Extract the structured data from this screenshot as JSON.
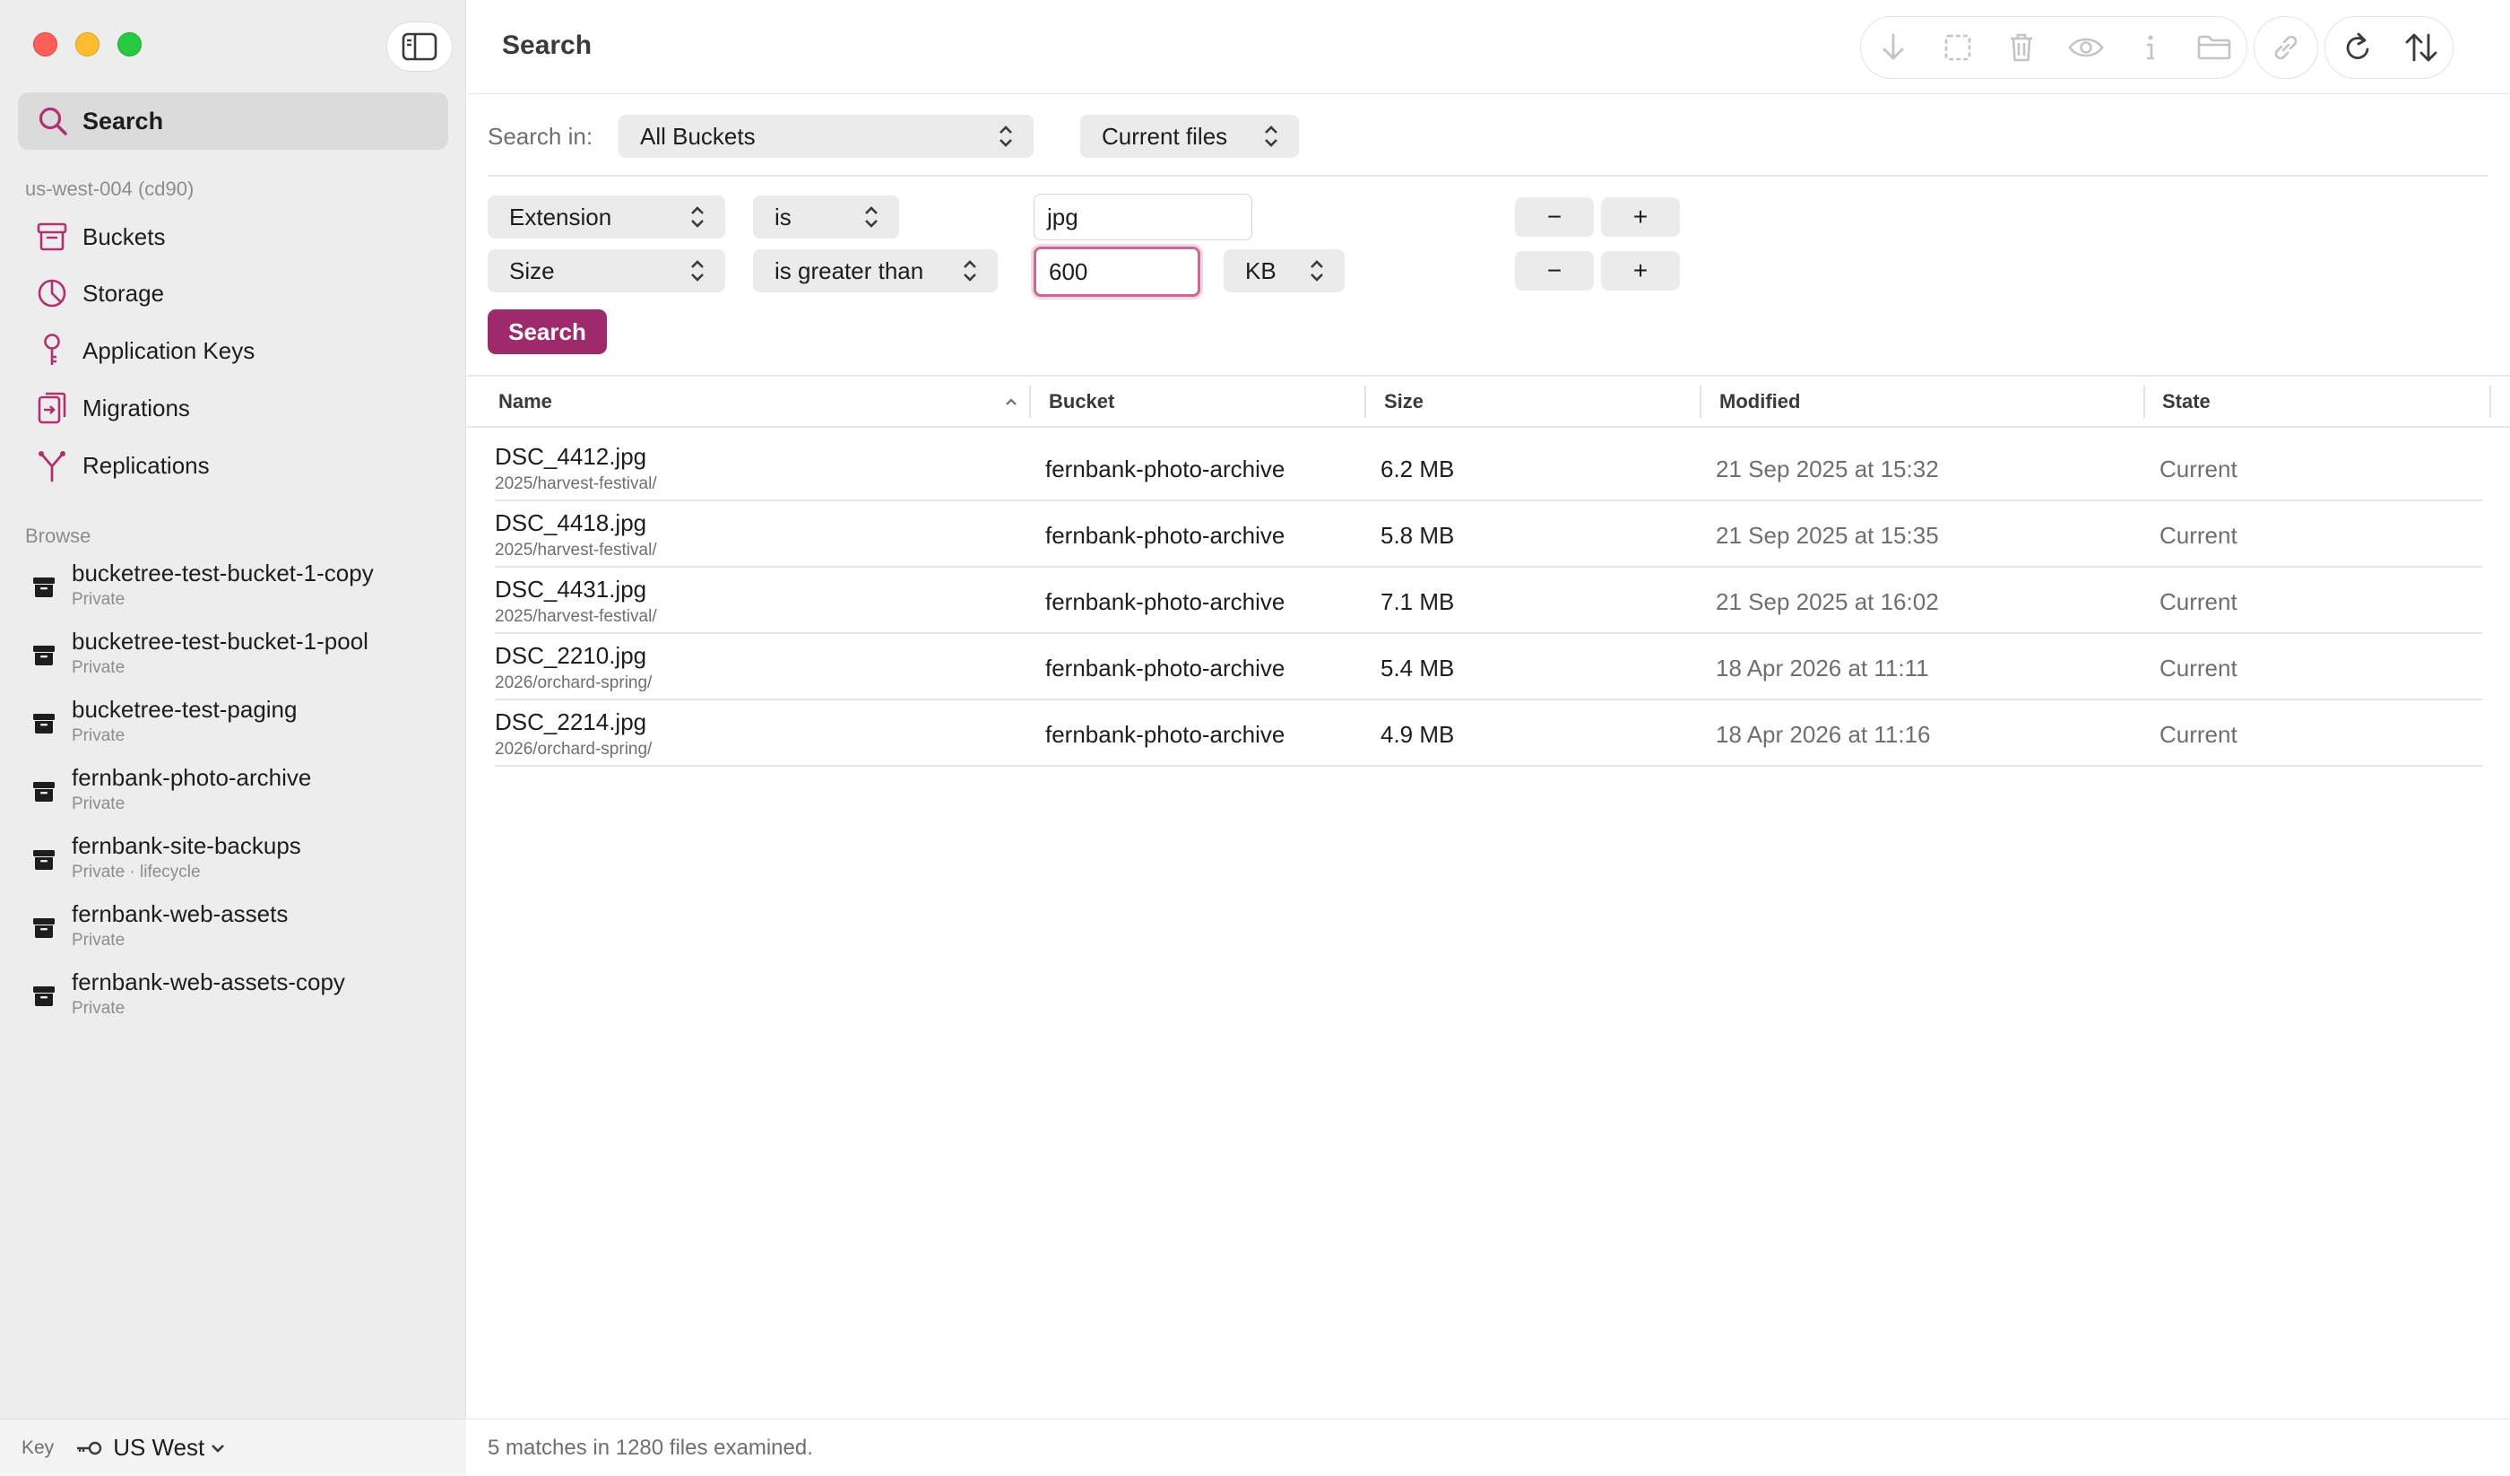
{
  "window": {
    "title": "Search"
  },
  "sidebar": {
    "search_label": "Search",
    "account_label": "us-west-004 (cd90)",
    "nav": [
      {
        "label": "Buckets",
        "icon": "bucket-icon"
      },
      {
        "label": "Storage",
        "icon": "pie-chart-icon"
      },
      {
        "label": "Application Keys",
        "icon": "key-icon"
      },
      {
        "label": "Migrations",
        "icon": "migration-icon"
      },
      {
        "label": "Replications",
        "icon": "replication-icon"
      }
    ],
    "browse_label": "Browse",
    "buckets": [
      {
        "name": "bucketree-test-bucket-1-copy",
        "sub": "Private"
      },
      {
        "name": "bucketree-test-bucket-1-pool",
        "sub": "Private"
      },
      {
        "name": "bucketree-test-paging",
        "sub": "Private"
      },
      {
        "name": "fernbank-photo-archive",
        "sub": "Private"
      },
      {
        "name": "fernbank-site-backups",
        "sub": "Private · lifecycle"
      },
      {
        "name": "fernbank-web-assets",
        "sub": "Private"
      },
      {
        "name": "fernbank-web-assets-copy",
        "sub": "Private"
      }
    ],
    "footer": {
      "key_label": "Key",
      "region": "US West"
    }
  },
  "search": {
    "search_in_label": "Search in:",
    "scope": "All Buckets",
    "versions": "Current files",
    "filters": [
      {
        "field": "Extension",
        "op": "is",
        "value": "jpg",
        "unit": ""
      },
      {
        "field": "Size",
        "op": "is greater than",
        "value": "600",
        "unit": "KB"
      }
    ],
    "minus": "−",
    "plus": "+",
    "button": "Search"
  },
  "table": {
    "columns": [
      "Name",
      "Bucket",
      "Size",
      "Modified",
      "State"
    ],
    "rows": [
      {
        "name": "DSC_4412.jpg",
        "path": "2025/harvest-festival/",
        "bucket": "fernbank-photo-archive",
        "size": "6.2 MB",
        "modified": "21 Sep 2025 at 15:32",
        "state": "Current"
      },
      {
        "name": "DSC_4418.jpg",
        "path": "2025/harvest-festival/",
        "bucket": "fernbank-photo-archive",
        "size": "5.8 MB",
        "modified": "21 Sep 2025 at 15:35",
        "state": "Current"
      },
      {
        "name": "DSC_4431.jpg",
        "path": "2025/harvest-festival/",
        "bucket": "fernbank-photo-archive",
        "size": "7.1 MB",
        "modified": "21 Sep 2025 at 16:02",
        "state": "Current"
      },
      {
        "name": "DSC_2210.jpg",
        "path": "2026/orchard-spring/",
        "bucket": "fernbank-photo-archive",
        "size": "5.4 MB",
        "modified": "18 Apr 2026 at 11:11",
        "state": "Current"
      },
      {
        "name": "DSC_2214.jpg",
        "path": "2026/orchard-spring/",
        "bucket": "fernbank-photo-archive",
        "size": "4.9 MB",
        "modified": "18 Apr 2026 at 11:16",
        "state": "Current"
      }
    ]
  },
  "status": "5 matches in 1280 files examined.",
  "colors": {
    "accent": "#9e2a6c",
    "icon_accent": "#b1306f"
  }
}
